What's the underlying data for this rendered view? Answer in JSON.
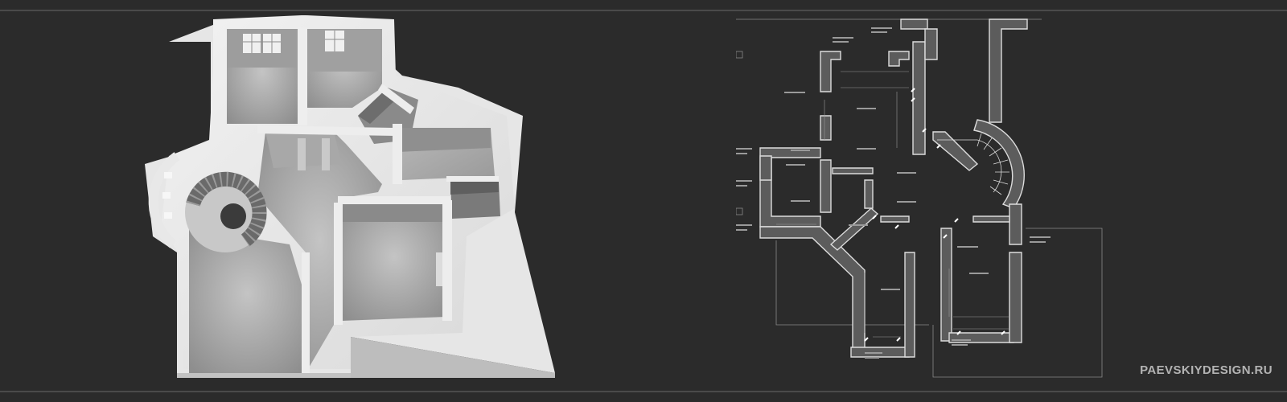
{
  "watermark": {
    "text": "PAEVSKIYDESIGN.RU"
  },
  "colors": {
    "background": "#2b2b2b",
    "rule": "#4a4a4a",
    "plan_lines": "#d8d8d8",
    "watermark": "#b3b3b3"
  },
  "images": {
    "render": "3d-floor-plan-render",
    "plan": "2d-architectural-floor-plan"
  }
}
